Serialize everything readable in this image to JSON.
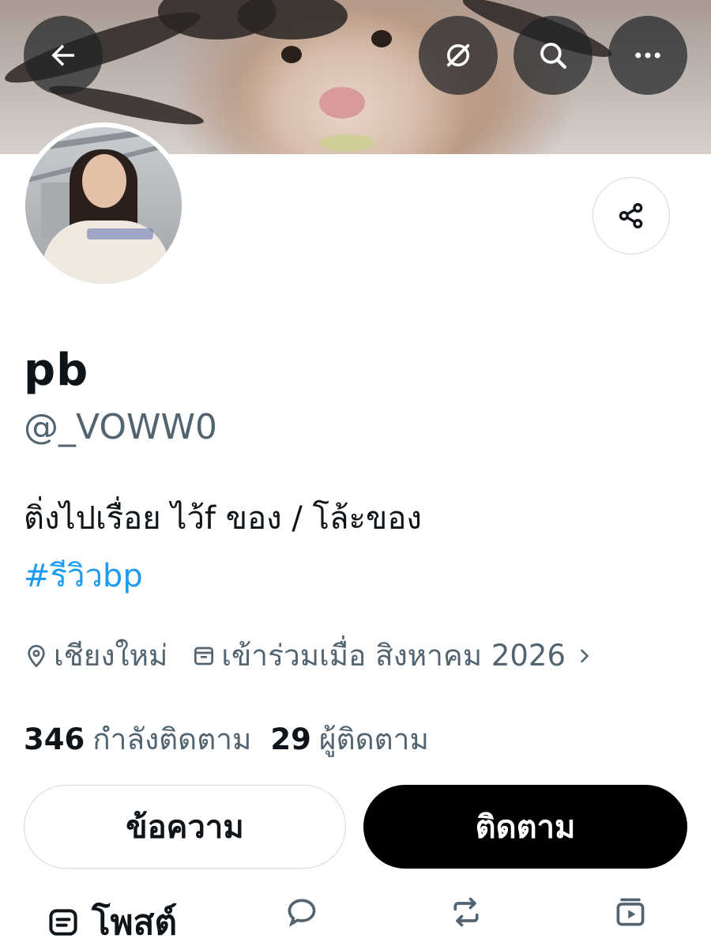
{
  "header": {
    "back_icon": "arrow-left-icon",
    "grok_icon": "slash-circle-icon",
    "search_icon": "search-icon",
    "more_icon": "more-horizontal-icon"
  },
  "profile": {
    "display_name": "pb",
    "handle": "@_VOWW0",
    "bio": "ติ่งไปเรื่อย ไว้f ของ / โล้ะของ",
    "hashtag": "#รีวิวbp",
    "location": "เชียงใหม่",
    "joined": "เข้าร่วมเมื่อ สิงหาคม 2026",
    "following_count": "346",
    "following_label": "กำลังติดตาม",
    "followers_count": "29",
    "followers_label": "ผู้ติดตาม"
  },
  "actions": {
    "message_label": "ข้อความ",
    "follow_label": "ติดตาม"
  },
  "tabs": {
    "posts_label": "โพสต์"
  },
  "colors": {
    "link": "#1d9bf0",
    "secondary_text": "#536471",
    "primary_text": "#0f1419",
    "follow_button": "#000000",
    "border": "#cfd9de"
  }
}
